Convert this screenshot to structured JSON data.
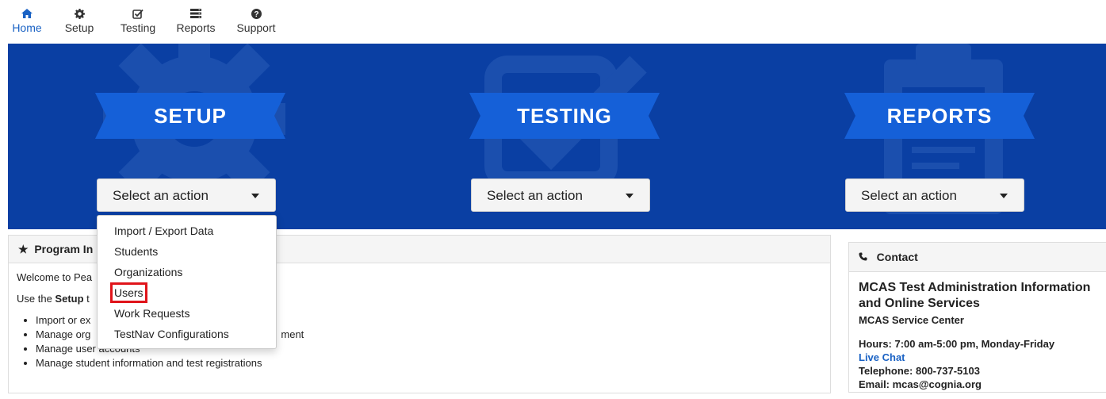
{
  "nav": {
    "items": [
      {
        "label": "Home",
        "icon": "home-icon"
      },
      {
        "label": "Setup",
        "icon": "gear-icon"
      },
      {
        "label": "Testing",
        "icon": "check-square-icon"
      },
      {
        "label": "Reports",
        "icon": "server-icon"
      },
      {
        "label": "Support",
        "icon": "question-circle-icon"
      }
    ],
    "active": "Home",
    "active_color": "#1a62c4"
  },
  "banner": {
    "bg_color": "#0a3fa3",
    "sections": [
      {
        "title": "SETUP",
        "select_label": "Select an action",
        "bg_icon": "gear-icon"
      },
      {
        "title": "TESTING",
        "select_label": "Select an action",
        "bg_icon": "check-square-icon"
      },
      {
        "title": "REPORTS",
        "select_label": "Select an action",
        "bg_icon": "clipboard-icon"
      }
    ]
  },
  "setup_menu": {
    "items": [
      "Import / Export Data",
      "Students",
      "Organizations",
      "Users",
      "Work Requests",
      "TestNav Configurations"
    ],
    "highlighted": "Users",
    "highlight_color": "#e0141a"
  },
  "program_info": {
    "heading": "Program In",
    "welcome": "Welcome to Pea",
    "use_prefix": "Use the ",
    "use_bold": "Setup",
    "use_suffix": " t",
    "bullets": [
      "Import or ex",
      "Manage org",
      "Manage user accounts",
      "Manage student information and test registrations"
    ],
    "bullet_2_tail": "ment"
  },
  "contact": {
    "heading": "Contact",
    "title": "MCAS Test Administration Information and Online Services",
    "subtitle": "MCAS Service Center",
    "hours": "Hours: 7:00 am-5:00 pm, Monday-Friday",
    "live_chat": "Live Chat",
    "telephone": "Telephone: 800-737-5103",
    "email_partial": "Email: mcas@cognia.org"
  }
}
